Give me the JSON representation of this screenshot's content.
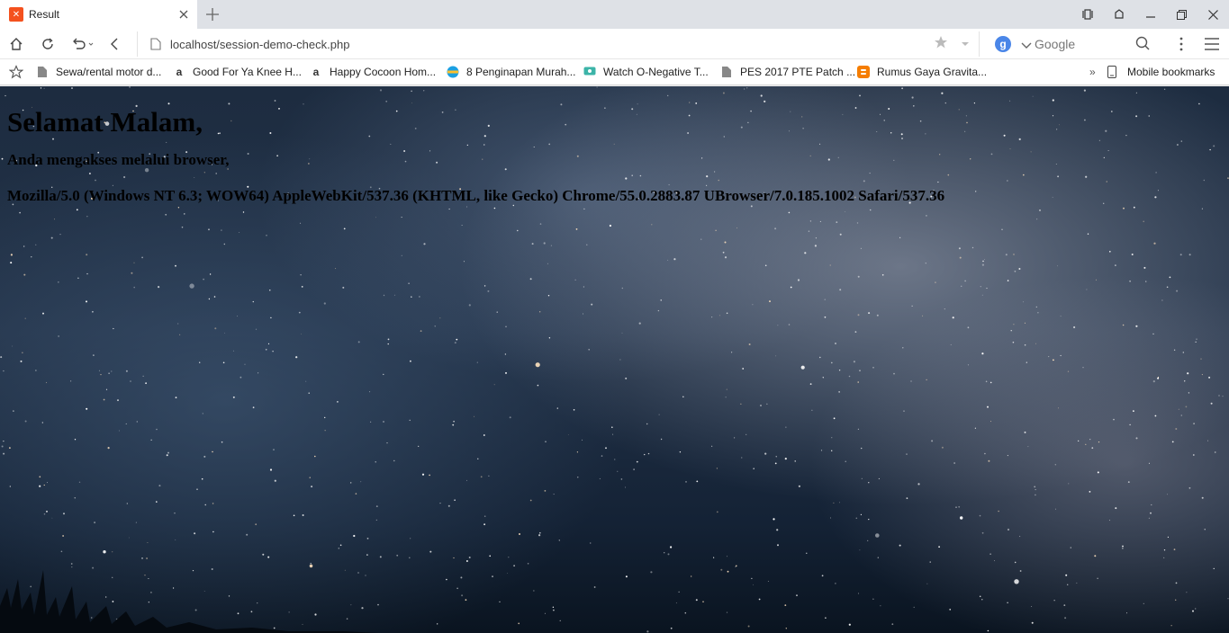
{
  "tab": {
    "title": "Result",
    "favicon_icon": "xampp-icon",
    "close_icon": "close-icon"
  },
  "new_tab_icon": "plus-icon",
  "window_controls": [
    "sidebar-icon",
    "extension-icon",
    "minimize-icon",
    "restore-icon",
    "close-icon"
  ],
  "toolbar": {
    "icons": [
      "home-icon",
      "reload-icon",
      "undo-icon",
      "back-icon"
    ],
    "url": "localhost/session-demo-check.php",
    "search_engine_badge": "g",
    "search_placeholder": "Google"
  },
  "bookmarks": {
    "items": [
      {
        "label": "Sewa/rental motor d...",
        "icon": "page-icon"
      },
      {
        "label": "Good For Ya Knee H...",
        "icon": "amazon-icon"
      },
      {
        "label": "Happy Cocoon Hom...",
        "icon": "amazon-icon"
      },
      {
        "label": "8 Penginapan Murah...",
        "icon": "traveloka-icon"
      },
      {
        "label": "Watch O-Negative T...",
        "icon": "tv-icon"
      },
      {
        "label": "PES 2017 PTE Patch ...",
        "icon": "page-icon"
      },
      {
        "label": "Rumus Gaya Gravita...",
        "icon": "blogger-icon"
      }
    ],
    "overflow": "»",
    "mobile": "Mobile bookmarks"
  },
  "page": {
    "greeting": "Selamat Malam,",
    "info": "Anda mengakses melalui browser,",
    "user_agent": "Mozilla/5.0 (Windows NT 6.3; WOW64) AppleWebKit/537.36 (KHTML, like Gecko) Chrome/55.0.2883.87 UBrowser/7.0.185.1002 Safari/537.36"
  },
  "colors": {
    "accent_orange": "#f4511e",
    "google_blue": "#4a86e8",
    "sky": "#1d2c40"
  }
}
